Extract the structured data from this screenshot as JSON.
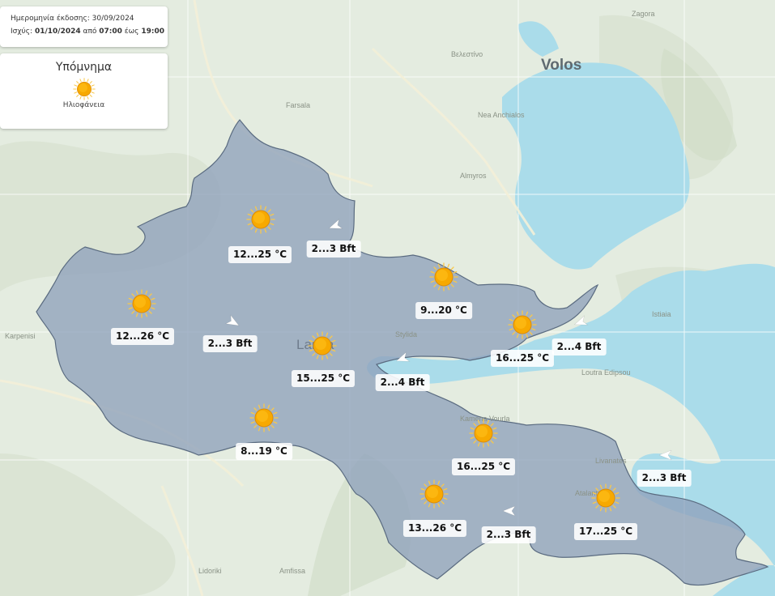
{
  "info": {
    "issue_label": "Ημερομηνία έκδοσης:",
    "issue_date": "30/09/2024",
    "valid_label": "Ισχύς:",
    "valid_date": "01/10/2024",
    "from_word": "από",
    "from_time": "07:00",
    "to_word": "έως",
    "to_time": "19:00"
  },
  "legend": {
    "title": "Υπόμνημα",
    "icon": "sun-icon",
    "item_label": "Ηλιοφάνεια"
  },
  "places": [
    {
      "name": "Volos",
      "size": "big"
    },
    {
      "name": "Lamia",
      "size": "mid"
    },
    {
      "name": "Βελεστίνο"
    },
    {
      "name": "Farsala"
    },
    {
      "name": "Nea Anchialos"
    },
    {
      "name": "Almyros"
    },
    {
      "name": "Istiaia"
    },
    {
      "name": "Loutra Edipsou"
    },
    {
      "name": "Karpenisi"
    },
    {
      "name": "Stylida"
    },
    {
      "name": "Kamena Vourla"
    },
    {
      "name": "Livanates"
    },
    {
      "name": "Atalanti"
    },
    {
      "name": "Lidoriki"
    },
    {
      "name": "Amfissa"
    },
    {
      "name": "Zagora"
    }
  ],
  "forecasts": [
    {
      "temp": "12...25 °C",
      "wind": "2...3 Bft",
      "wind_direction_deg": 250,
      "weather": "sun-icon"
    },
    {
      "temp": "12...26 °C",
      "wind": "2...3 Bft",
      "wind_direction_deg": 120,
      "weather": "sun-icon"
    },
    {
      "temp": "15...25 °C",
      "wind": "2...4 Bft",
      "wind_direction_deg": 250,
      "weather": "sun-icon"
    },
    {
      "temp": "9...20 °C",
      "weather": "sun-icon"
    },
    {
      "temp": "16...25 °C",
      "wind": "2...4 Bft",
      "wind_direction_deg": 250,
      "weather": "sun-icon"
    },
    {
      "temp": "8...19 °C",
      "weather": "sun-icon"
    },
    {
      "temp": "16...25 °C",
      "weather": "sun-icon"
    },
    {
      "temp": "13...26 °C",
      "wind": "2...3 Bft",
      "wind_direction_deg": 270,
      "weather": "sun-icon"
    },
    {
      "temp": "17...25 °C",
      "wind": "2...3 Bft",
      "wind_direction_deg": 270,
      "weather": "sun-icon"
    }
  ],
  "colors": {
    "sea": "#aadcea",
    "land": "#e4ece0",
    "region_fill": "#8fa2bb",
    "region_stroke": "#5a6b80",
    "sun_core": "#f7a900",
    "sun_ray": "#f9c84a"
  }
}
